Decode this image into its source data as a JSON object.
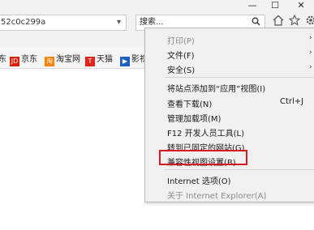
{
  "toolbar": {
    "address_text": "52c0c299a",
    "address_icon": "▾",
    "search_placeholder": "搜索...",
    "search_icon": "search-icon",
    "window_buttons": {
      "minimize": "—",
      "maximize": "☐",
      "close": "✕"
    },
    "icons": [
      "home-icon",
      "star-icon",
      "gear-icon"
    ]
  },
  "favorites": [
    {
      "label": "京东",
      "badge": "JD",
      "color": "#d81e06",
      "prefix": "东"
    },
    {
      "label": "淘宝网",
      "badge": "淘",
      "color": "#ff7f00"
    },
    {
      "label": "天猫",
      "badge": "T",
      "color": "#e2231a"
    },
    {
      "label": "影视",
      "badge": "▶",
      "color": "#1f5fbf"
    }
  ],
  "favorites_prefix": "东",
  "menu": {
    "items": [
      {
        "label": "打印(P)",
        "disabled": true,
        "arrow": true
      },
      {
        "label": "文件(F)",
        "disabled": false,
        "arrow": true
      },
      {
        "label": "安全(S)",
        "disabled": false,
        "arrow": true
      },
      {
        "label": "将站点添加到“应用”视图(I)",
        "disabled": false
      },
      {
        "label": "查看下载(N)",
        "disabled": false,
        "shortcut": "Ctrl+J"
      },
      {
        "label": "管理加载项(M)",
        "disabled": false
      },
      {
        "label": "F12 开发人员工具(L)",
        "disabled": false
      },
      {
        "label": "转到已固定的网站(G)",
        "disabled": false
      },
      {
        "label": "兼容性视图设置(B)",
        "disabled": false,
        "highlighted": true
      },
      {
        "label": "Internet 选项(O)",
        "disabled": false
      },
      {
        "label": "关于 Internet Explorer(A)",
        "disabled": true
      }
    ],
    "arrow_glyph": "›",
    "highlight_color": "#d61a1a"
  }
}
